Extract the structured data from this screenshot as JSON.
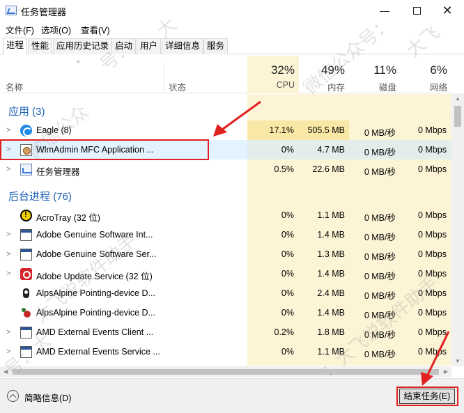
{
  "window": {
    "title": "任务管理器",
    "controls": {
      "minimize": "—",
      "close": "✕"
    }
  },
  "menu": [
    "文件(F)",
    "选项(O)",
    "查看(V)"
  ],
  "tabs": [
    "进程",
    "性能",
    "应用历史记录",
    "启动",
    "用户",
    "详细信息",
    "服务"
  ],
  "header": {
    "sort_indicator": "^",
    "name_label": "名称",
    "status_label": "状态",
    "columns": [
      {
        "percent": "32%",
        "label": "CPU"
      },
      {
        "percent": "49%",
        "label": "内存"
      },
      {
        "percent": "11%",
        "label": "磁盘"
      },
      {
        "percent": "6%",
        "label": "网络"
      }
    ]
  },
  "groups": {
    "apps": "应用 (3)",
    "background": "后台进程 (76)"
  },
  "app_rows": [
    {
      "name": "Eagle (8)",
      "icon": "eagle-icon",
      "cpu": "17.1%",
      "mem": "505.5 MB",
      "disk": "0 MB/秒",
      "net": "0 Mbps"
    },
    {
      "name": "WlmAdmin MFC Application ...",
      "icon": "wlmadmin-icon",
      "cpu": "0%",
      "mem": "4.7 MB",
      "disk": "0 MB/秒",
      "net": "0 Mbps"
    },
    {
      "name": "任务管理器",
      "icon": "task-manager-icon",
      "cpu": "0.5%",
      "mem": "22.6 MB",
      "disk": "0 MB/秒",
      "net": "0 Mbps"
    }
  ],
  "background_rows": [
    {
      "name": "AcroTray (32 位)",
      "icon": "acrotray-icon",
      "cpu": "0%",
      "mem": "1.1 MB",
      "disk": "0 MB/秒",
      "net": "0 Mbps"
    },
    {
      "name": "Adobe Genuine Software Int...",
      "icon": "window-icon",
      "cpu": "0%",
      "mem": "1.4 MB",
      "disk": "0 MB/秒",
      "net": "0 Mbps"
    },
    {
      "name": "Adobe Genuine Software Ser...",
      "icon": "window-icon",
      "cpu": "0%",
      "mem": "1.3 MB",
      "disk": "0 MB/秒",
      "net": "0 Mbps"
    },
    {
      "name": "Adobe Update Service (32 位)",
      "icon": "adobe-icon",
      "cpu": "0%",
      "mem": "1.4 MB",
      "disk": "0 MB/秒",
      "net": "0 Mbps"
    },
    {
      "name": "AlpsAlpine Pointing-device D...",
      "icon": "alps-icon",
      "cpu": "0%",
      "mem": "2.4 MB",
      "disk": "0 MB/秒",
      "net": "0 Mbps"
    },
    {
      "name": "AlpsAlpine Pointing-device D...",
      "icon": "alps-red-icon",
      "cpu": "0%",
      "mem": "1.4 MB",
      "disk": "0 MB/秒",
      "net": "0 Mbps"
    },
    {
      "name": "AMD External Events Client ...",
      "icon": "window-icon",
      "cpu": "0.2%",
      "mem": "1.8 MB",
      "disk": "0 MB/秒",
      "net": "0 Mbps"
    },
    {
      "name": "AMD External Events Service ...",
      "icon": "window-icon",
      "cpu": "0%",
      "mem": "1.1 MB",
      "disk": "0 MB/秒",
      "net": "0 Mbps"
    }
  ],
  "footer": {
    "fewer_details": "简略信息(D)",
    "end_task": "结束任务(E)"
  },
  "colors": {
    "group_title": "#1a5fb4",
    "cpu_heat_high": "#f9e8a5",
    "cpu_heat_low": "#fdf4d6",
    "selection": "#cce8ff",
    "annotation_red": "#e12020"
  },
  "watermarks": [
    "大",
    "号：",
    "微信公众号：",
    "大飞",
    "微信公众",
    "大飞说软件助手",
    "：大飞说软件助手",
    "号：大"
  ]
}
